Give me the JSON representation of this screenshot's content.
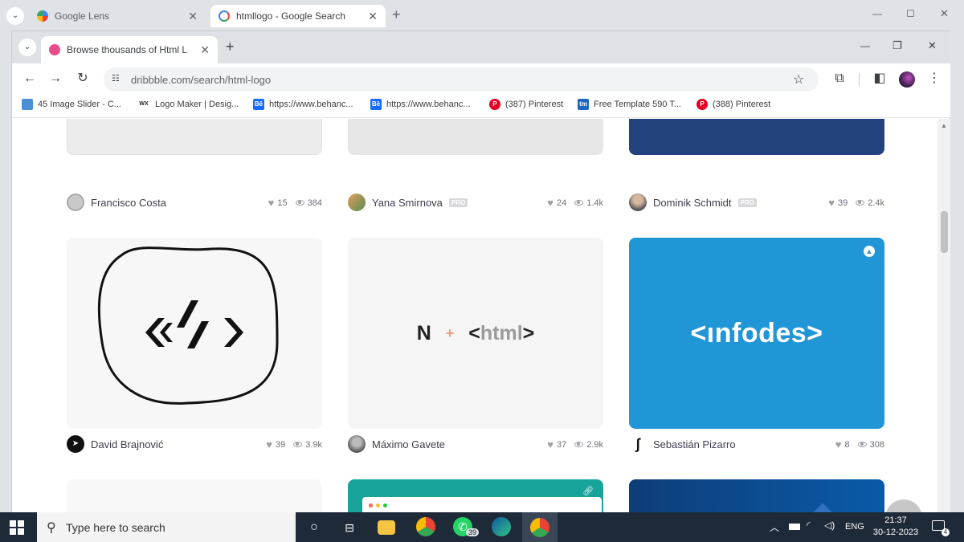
{
  "outer_tabs": [
    {
      "title": "Google Lens",
      "close": "✕"
    },
    {
      "title": "htmllogo - Google Search",
      "close": "✕"
    }
  ],
  "outer_controls": {
    "minimize": "—",
    "restore": "◻",
    "close": "✕",
    "new_tab": "+"
  },
  "inner_tab": {
    "title": "Browse thousands of Html Log",
    "close": "✕",
    "new_tab": "+"
  },
  "inner_controls": {
    "minimize": "—",
    "restore": "❐",
    "close": "✕"
  },
  "address_bar": {
    "url": "dribbble.com/search/html-logo"
  },
  "bookmarks": [
    {
      "label": "45 Image Slider - C...",
      "icon_text": "",
      "color": "#4a90d9"
    },
    {
      "label": "Logo Maker | Desig...",
      "icon_text": "WX",
      "color": "#ffffff"
    },
    {
      "label": "https://www.behanc...",
      "icon_text": "Bē",
      "color": "#1769ff"
    },
    {
      "label": "https://www.behanc...",
      "icon_text": "Bē",
      "color": "#1769ff"
    },
    {
      "label": "(387) Pinterest",
      "icon_text": "P",
      "color": "#e60023"
    },
    {
      "label": "Free Template 590 T...",
      "icon_text": "tm",
      "color": "#1c66c2"
    },
    {
      "label": "(388) Pinterest",
      "icon_text": "P",
      "color": "#e60023"
    }
  ],
  "shots_row1": [
    {
      "author": "Francisco Costa",
      "pro": "",
      "likes": "15",
      "views": "384"
    },
    {
      "author": "Yana Smirnova",
      "pro": "PRO",
      "likes": "24",
      "views": "1.4k"
    },
    {
      "author": "Dominik Schmidt",
      "pro": "PRO",
      "likes": "39",
      "views": "2.4k"
    }
  ],
  "shots_row2": [
    {
      "author": "David Brajnović",
      "likes": "39",
      "views": "3.9k"
    },
    {
      "author": "Máximo Gavete",
      "likes": "37",
      "views": "2.9k"
    },
    {
      "author": "Sebastián Pizarro",
      "likes": "8",
      "views": "308"
    }
  ],
  "shot_texts": {
    "n_letter": "N",
    "plus": "+",
    "html_open": "<",
    "html_word": "html",
    "html_close": ">",
    "infodes": "<ınfodes>"
  },
  "taskbar": {
    "search_placeholder": "Type here to search",
    "whatsapp_badge": "39",
    "lang": "ENG",
    "time": "21:37",
    "date": "30-12-2023",
    "notification_count": "4"
  },
  "colors": {
    "infodes_bg": "#2196d6",
    "navy_card": "#23427e",
    "teal_card": "#17a39a",
    "dark_blue_card": "#0e3d78"
  }
}
